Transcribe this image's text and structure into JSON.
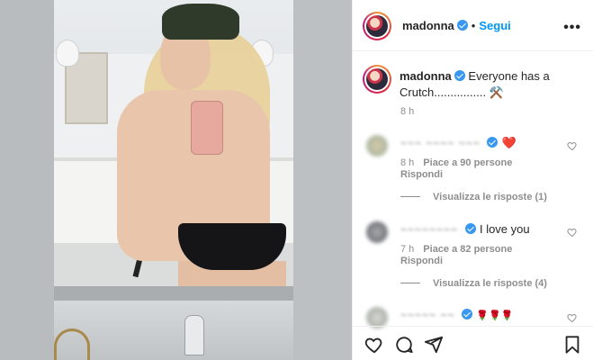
{
  "post": {
    "username": "madonna",
    "follow_label": "Segui",
    "more_label": "•••",
    "caption_text": "Everyone has a Crutch................ ⚒️",
    "caption_time": "8 h"
  },
  "comments": [
    {
      "user": "~~~ ~~~~ ~~~",
      "text": "❤️",
      "time": "8 h",
      "likes": "Piace a 90 persone",
      "reply_label": "Rispondi",
      "view_replies": "Visualizza le risposte (1)"
    },
    {
      "user": "~~~~~~~~",
      "text": "I love you",
      "time": "7 h",
      "likes": "Piace a 82 persone",
      "reply_label": "Rispondi",
      "view_replies": "Visualizza le risposte (4)"
    },
    {
      "user": "~~~~~ ~~",
      "text": "🌹🌹🌹",
      "time": "",
      "likes": "",
      "reply_label": "",
      "view_replies": ""
    }
  ],
  "icons": {
    "like": "heart-icon",
    "comment": "comment-icon",
    "share": "share-icon",
    "save": "bookmark-icon",
    "verified": "verified-badge-icon",
    "comment_like": "heart-outline-icon"
  },
  "colors": {
    "accent": "#0095f6",
    "verified": "#3897f0",
    "muted": "#8e8e8e",
    "text": "#262626"
  }
}
